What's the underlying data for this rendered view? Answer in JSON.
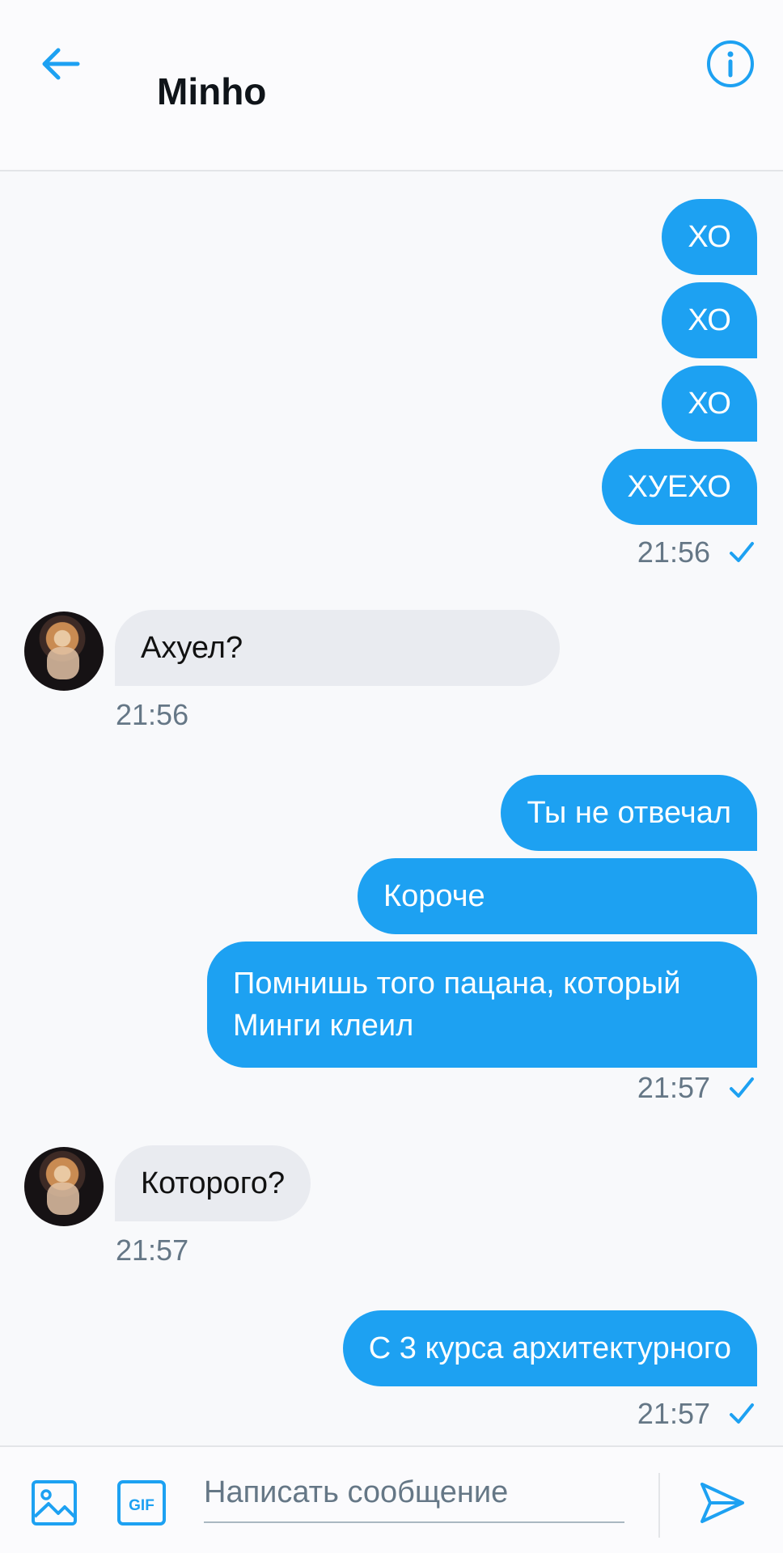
{
  "header": {
    "title": "Minho",
    "back_icon": "arrow-left-icon",
    "info_icon": "info-circle-icon"
  },
  "messages": [
    {
      "direction": "out",
      "text": "ХО"
    },
    {
      "direction": "out",
      "text": "ХО"
    },
    {
      "direction": "out",
      "text": "ХО"
    },
    {
      "direction": "out",
      "text": "ХУЕХО",
      "time": "21:56",
      "status": "sent-check"
    },
    {
      "direction": "in",
      "text": "Ахуел?",
      "time": "21:56"
    },
    {
      "direction": "out",
      "text": "Ты не отвечал"
    },
    {
      "direction": "out",
      "text": "Короче"
    },
    {
      "direction": "out",
      "text": "Помнишь того пацана, который Минги клеил",
      "time": "21:57",
      "status": "sent-check"
    },
    {
      "direction": "in",
      "text": "Которого?",
      "time": "21:57"
    },
    {
      "direction": "out",
      "text": "С 3 курса архитектурного",
      "time": "21:57",
      "status": "sent-check"
    }
  ],
  "composer": {
    "placeholder": "Написать сообщение",
    "value": "",
    "gif_label": "GIF",
    "image_icon": "image-icon",
    "send_icon": "send-icon"
  },
  "colors": {
    "accent": "#1da1f2",
    "incoming_bubble": "#e9ebf0",
    "timestamp": "#657786"
  }
}
